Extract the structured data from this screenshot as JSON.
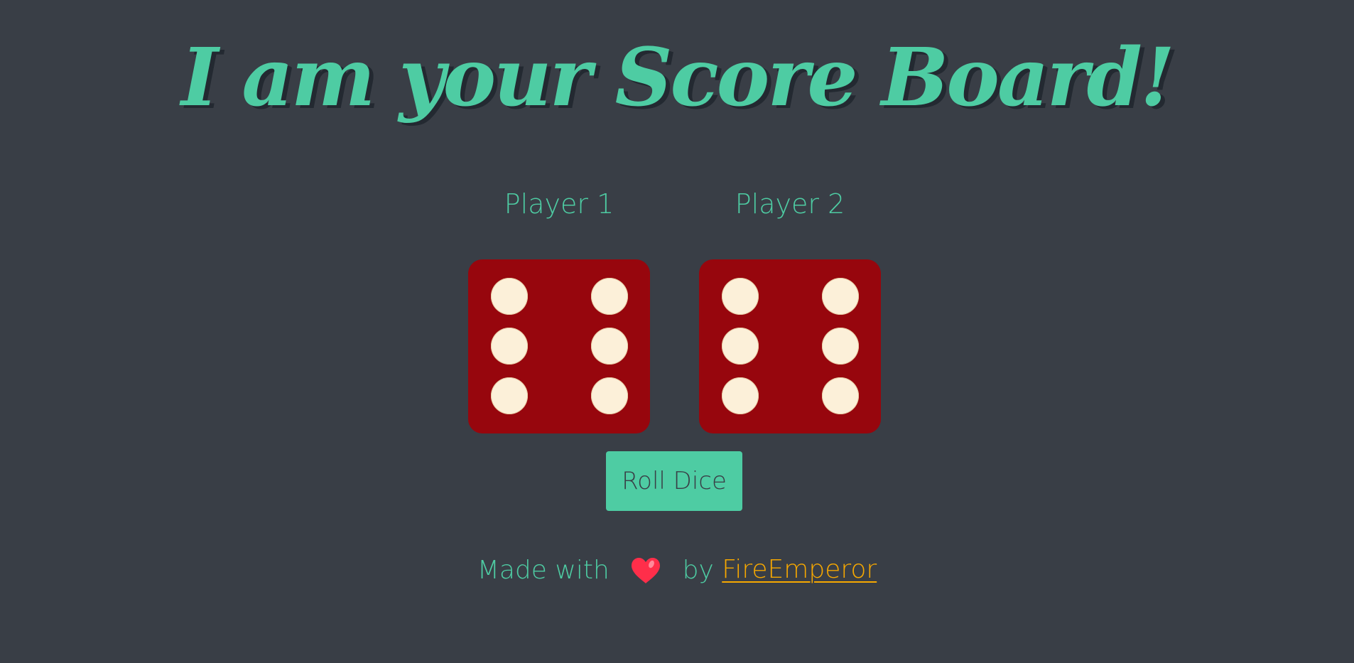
{
  "title": "I am your Score Board!",
  "players": [
    {
      "label": "Player 1",
      "die_value": 6
    },
    {
      "label": "Player 2",
      "die_value": 6
    }
  ],
  "roll_button": {
    "label": "Roll Dice"
  },
  "footer": {
    "made_with": "Made with",
    "heart_icon": "heart-icon",
    "by": "by",
    "author": "FireEmperor"
  },
  "colors": {
    "background": "#393e46",
    "accent": "#4ecca3",
    "die": "#97060d",
    "pip": "#fcf0d9",
    "link": "#f7a800",
    "heart": "#ff2e4a"
  }
}
